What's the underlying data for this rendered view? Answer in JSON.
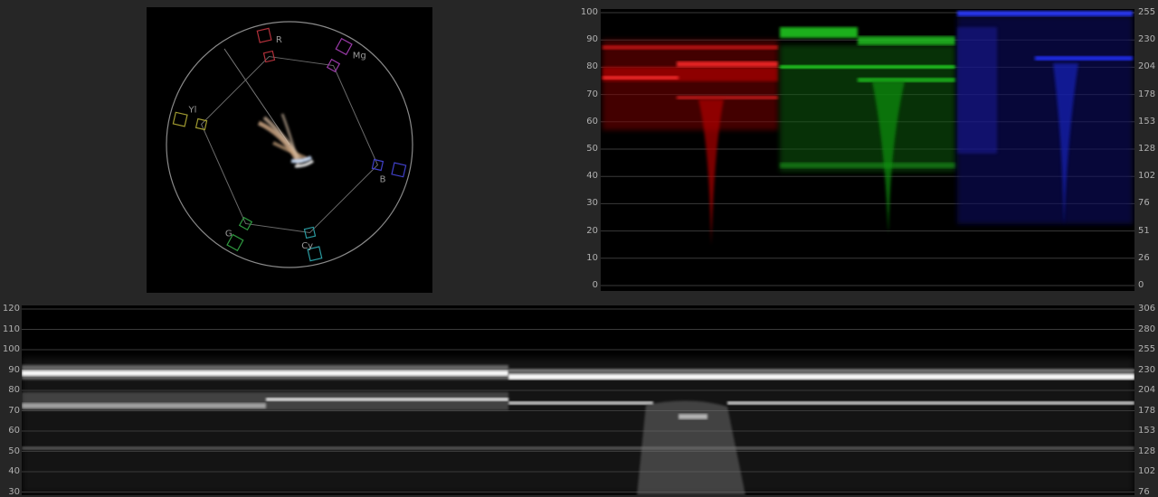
{
  "vectorscope": {
    "targets": [
      {
        "label": "R",
        "color": "#b0303a",
        "angle": 103
      },
      {
        "label": "Mg",
        "color": "#9a3aa8",
        "angle": 61
      },
      {
        "label": "B",
        "color": "#4040c8",
        "angle": -13
      },
      {
        "label": "Cy",
        "color": "#2a9aa0",
        "angle": -77
      },
      {
        "label": "G",
        "color": "#2f9a40",
        "angle": -119
      },
      {
        "label": "Yl",
        "color": "#a09a30",
        "angle": 167
      }
    ]
  },
  "parade": {
    "left_scale": [
      "100",
      "90",
      "80",
      "70",
      "60",
      "50",
      "40",
      "30",
      "20",
      "10",
      "0"
    ],
    "right_scale": [
      "255",
      "230",
      "204",
      "178",
      "153",
      "128",
      "102",
      "76",
      "51",
      "26",
      "0"
    ],
    "channels": [
      {
        "name": "red",
        "color": "#ff2020"
      },
      {
        "name": "green",
        "color": "#20ff20"
      },
      {
        "name": "blue",
        "color": "#2030ff"
      }
    ]
  },
  "waveform": {
    "left_scale": [
      "120",
      "110",
      "100",
      "90",
      "80",
      "70",
      "60",
      "50",
      "40",
      "30"
    ],
    "right_scale": [
      "306",
      "280",
      "255",
      "230",
      "204",
      "178",
      "153",
      "128",
      "102",
      "76"
    ]
  }
}
